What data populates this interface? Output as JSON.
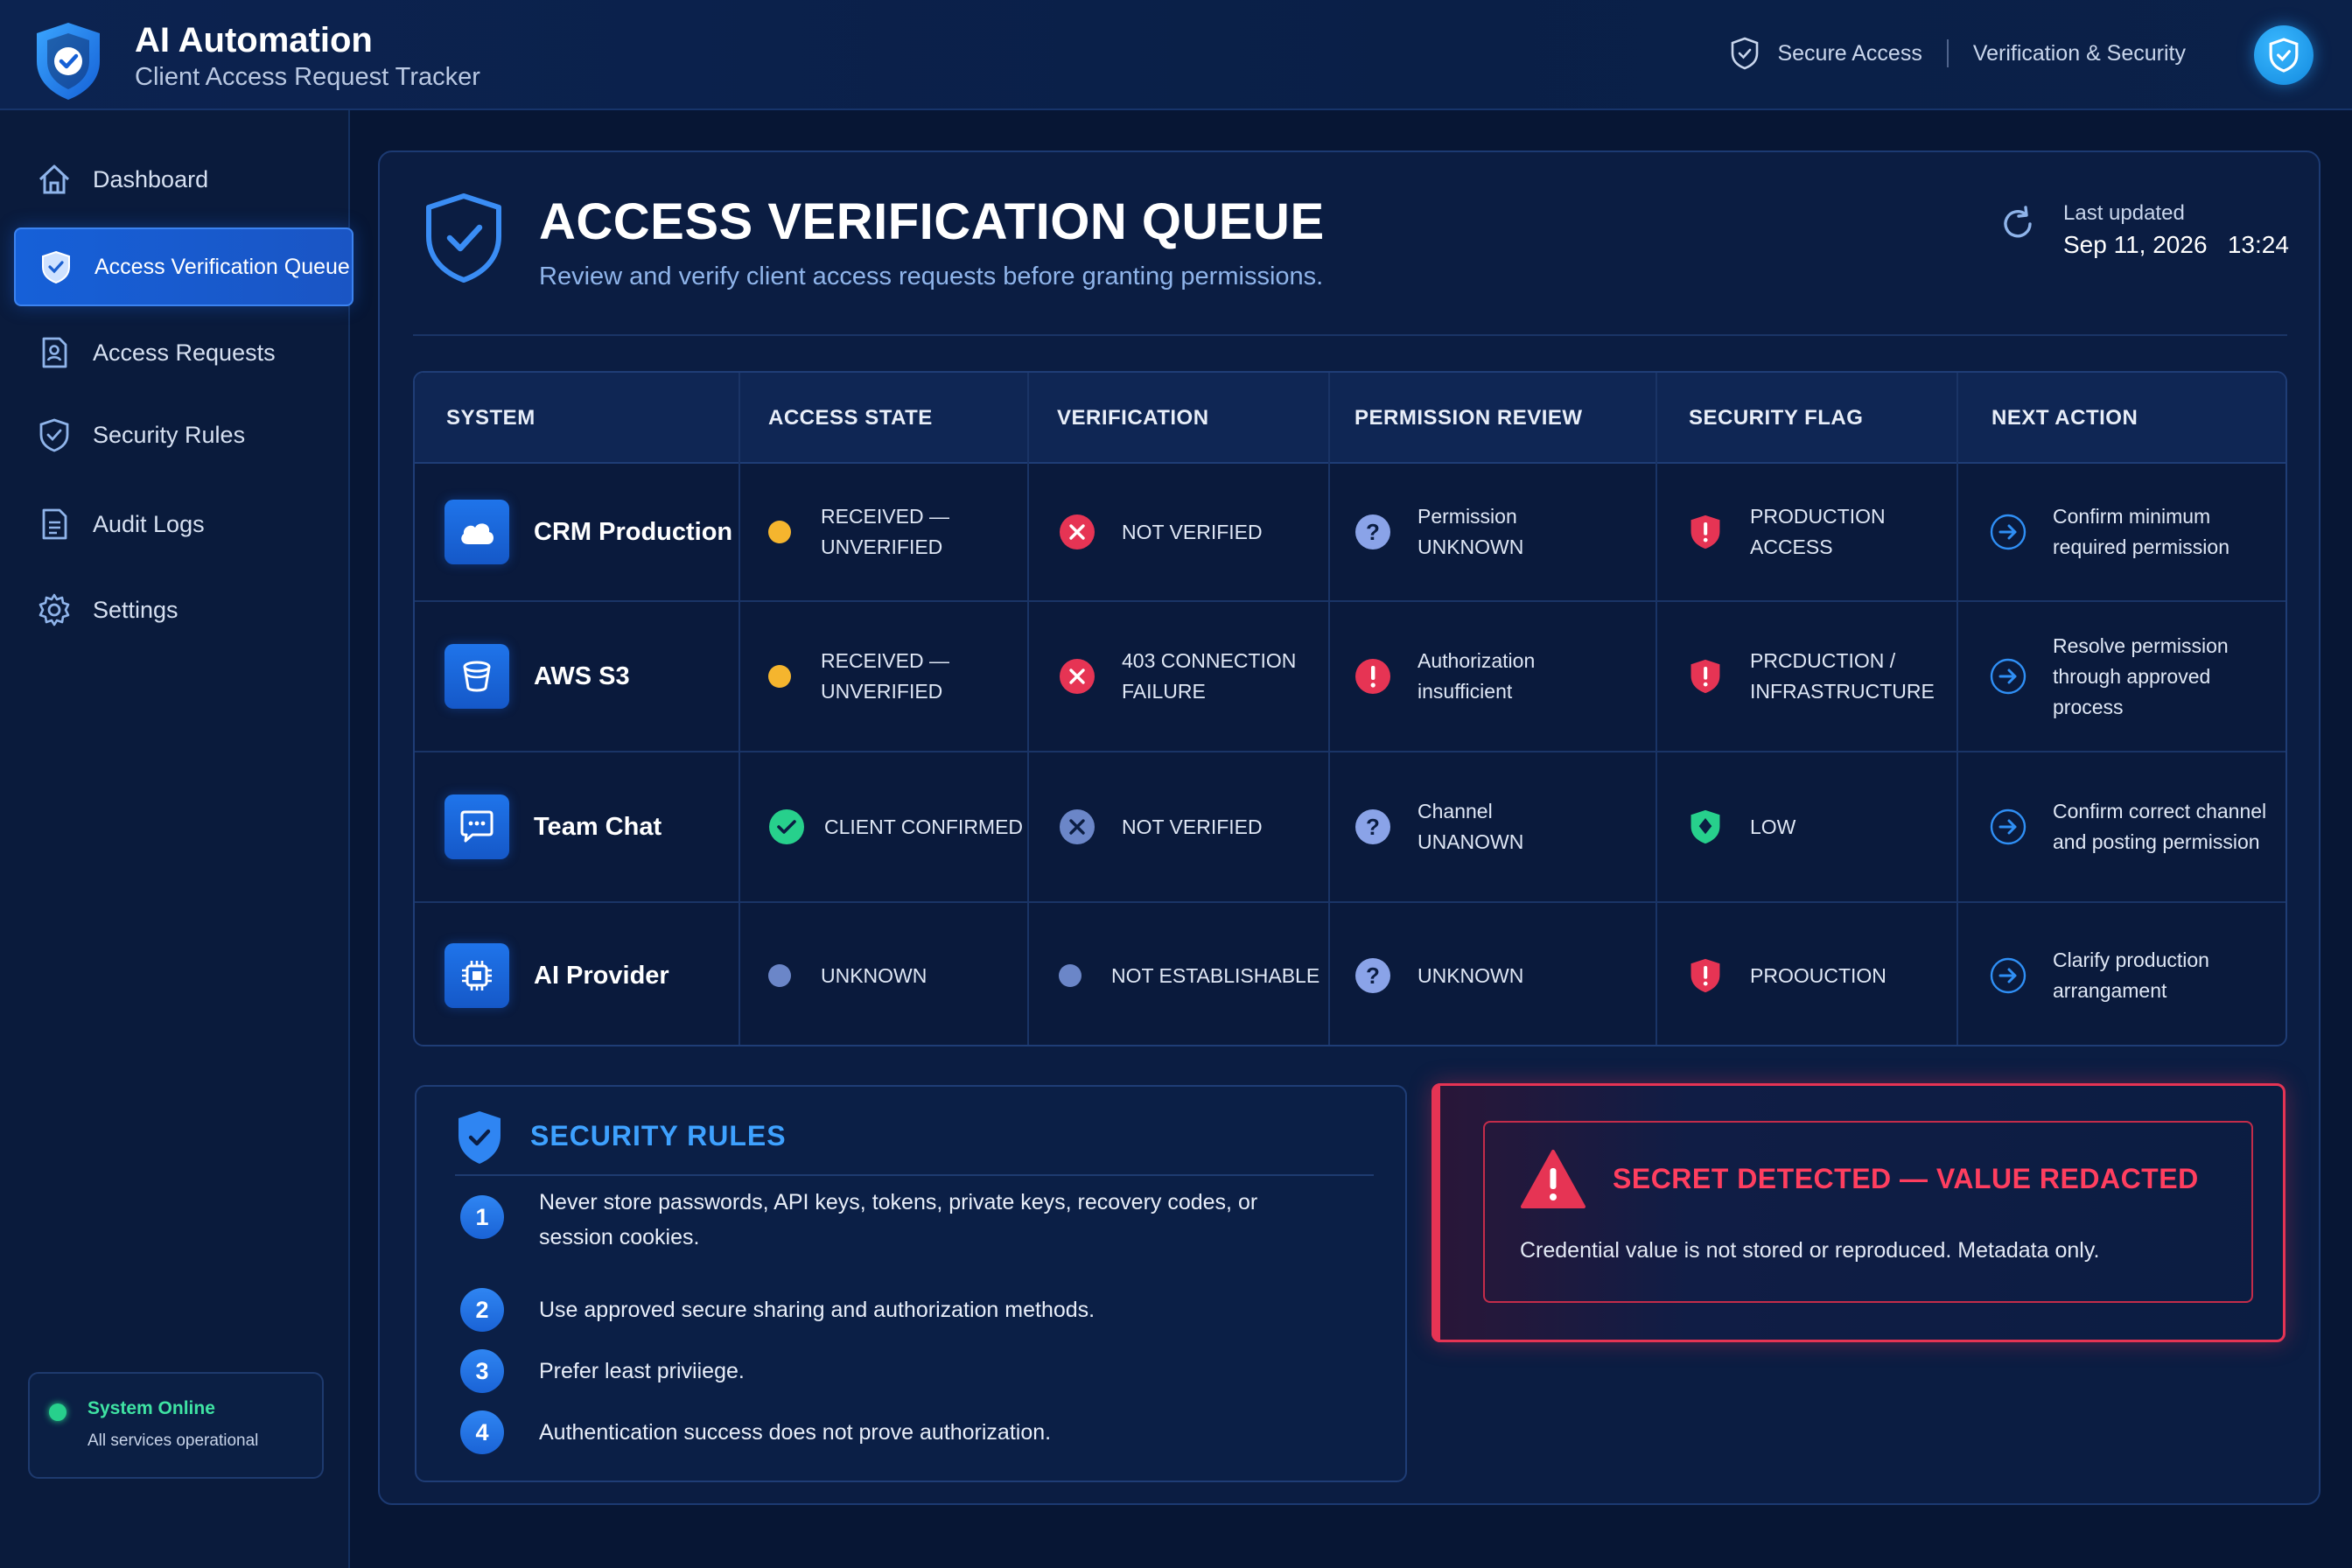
{
  "header": {
    "app_title": "AI Automation",
    "app_subtitle": "Client Access Request Tracker",
    "secure_access": "Secure Access",
    "verification_security": "Verification & Security"
  },
  "sidebar": {
    "items": [
      {
        "label": "Dashboard",
        "icon": "home-icon",
        "active": false
      },
      {
        "label": "Access Verification Queue",
        "icon": "shield-check-icon",
        "active": true
      },
      {
        "label": "Access Requests",
        "icon": "document-user-icon",
        "active": false
      },
      {
        "label": "Security Rules",
        "icon": "shield-check-icon",
        "active": false
      },
      {
        "label": "Audit Logs",
        "icon": "document-icon",
        "active": false
      },
      {
        "label": "Settings",
        "icon": "gear-icon",
        "active": false
      }
    ],
    "status": {
      "title": "System Online",
      "subtitle": "All services operational"
    }
  },
  "page": {
    "title": "ACCESS VERIFICATION QUEUE",
    "subtitle": "Review and verify client access requests before granting permissions.",
    "last_updated_label": "Last updated",
    "last_updated_value": "Sep 11, 2026   13:24"
  },
  "table": {
    "columns": [
      "SYSTEM",
      "ACCESS STATE",
      "VERIFICATION",
      "PERMISSION REVIEW",
      "SECURITY FLAG",
      "NEXT ACTION"
    ],
    "rows": [
      {
        "system": "CRM Production",
        "system_icon": "cloud-icon",
        "access_state": "RECEIVED —\nUNVERIFIED",
        "access_state_color": "#f5b52e",
        "verification": "NOT VERIFIED",
        "verification_icon": "x-circle-icon",
        "permission": "Permission\nUNKNOWN",
        "permission_icon": "question-icon",
        "flag": "PRODUCTION\nACCESS",
        "flag_icon": "alert-shield-icon",
        "next": "Confirm minimum\nrequired permission"
      },
      {
        "system": "AWS S3",
        "system_icon": "bucket-icon",
        "access_state": "RECEIVED —\nUNVERIFIED",
        "access_state_color": "#f5b52e",
        "verification": "403 CONNECTION\nFAILURE",
        "verification_icon": "x-circle-icon",
        "permission": "Authorization\ninsufficient",
        "permission_icon": "alert-circle-icon",
        "flag": "PRCDUCTION /\nINFRASTRUCTURE",
        "flag_icon": "alert-shield-icon",
        "next": "Resolve permission\nthrough approved\nprocess"
      },
      {
        "system": "Team Chat",
        "system_icon": "chat-icon",
        "access_state": "CLIENT CONFIRMED",
        "access_state_color": "#27d08c",
        "verification": "NOT VERIFIED",
        "verification_icon": "x-circle-muted-icon",
        "permission": "Channel\nUNANOWN",
        "permission_icon": "question-icon",
        "flag": "LOW",
        "flag_icon": "green-shield-icon",
        "next": "Confirm correct channel\nand posting permission"
      },
      {
        "system": "AI Provider",
        "system_icon": "chip-icon",
        "access_state": "UNKNOWN",
        "access_state_color": "#6b86c8",
        "verification": "NOT ESTABLISHABLE",
        "verification_icon": "dot-icon",
        "permission": "UNKNOWN",
        "permission_icon": "question-icon",
        "flag": "PROOUCTION",
        "flag_icon": "alert-shield-icon",
        "next": "Clarify production\narrangament"
      }
    ]
  },
  "rules": {
    "title": "SECURITY RULES",
    "items": [
      {
        "n": "1",
        "text": "Never store passwords, API keys, tokens, private keys, recovery codes, or session cookies."
      },
      {
        "n": "2",
        "text": "Use approved secure sharing and authorization methods."
      },
      {
        "n": "3",
        "text": "Prefer least priviiege."
      },
      {
        "n": "4",
        "text": "Authentication success does not prove authorization."
      }
    ]
  },
  "alert": {
    "title": "SECRET DETECTED — VALUE REDACTED",
    "body": "Credential value is not stored or reproduced. Metadata only."
  },
  "colors": {
    "accent_blue": "#1a63d6",
    "danger_red": "#e63454",
    "success_green": "#27d08c",
    "warning_amber": "#f5b52e"
  }
}
